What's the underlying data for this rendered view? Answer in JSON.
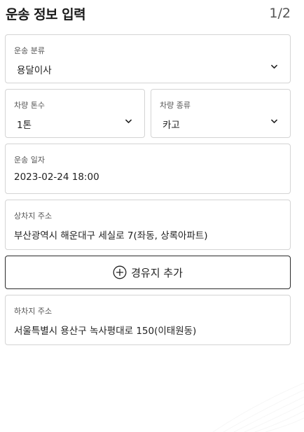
{
  "header": {
    "title": "운송 정보 입력",
    "step": "1/2"
  },
  "fields": {
    "transport_type": {
      "label": "운송 분류",
      "value": "용달이사"
    },
    "vehicle_tonnage": {
      "label": "차량 톤수",
      "value": "1톤"
    },
    "vehicle_type": {
      "label": "차량 종류",
      "value": "카고"
    },
    "transport_date": {
      "label": "운송 일자",
      "value": "2023-02-24 18:00"
    },
    "pickup_address": {
      "label": "상차지 주소",
      "value": "부산광역시 해운대구 세실로 7(좌동, 상록아파트)"
    },
    "dropoff_address": {
      "label": "하차지 주소",
      "value": "서울특별시 용산구 녹사평대로 150(이태원동)"
    }
  },
  "add_waypoint": {
    "label": "경유지 추가",
    "icon": "plus-circle-icon"
  },
  "colors": {
    "border": "#d4d4d4",
    "text": "#222222",
    "label": "#555555",
    "button_border": "#2a2a2a"
  }
}
